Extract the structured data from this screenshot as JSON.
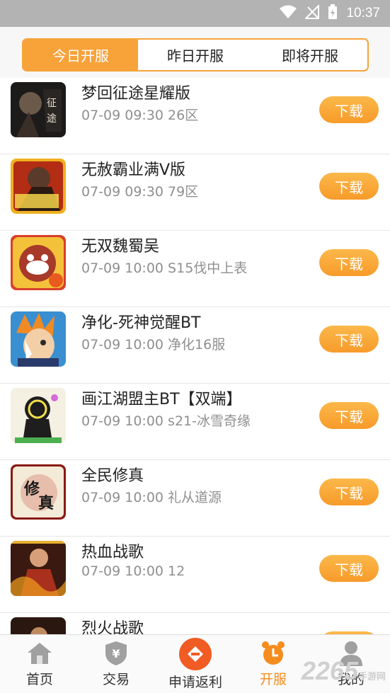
{
  "status": {
    "time": "10:37"
  },
  "tabs": [
    {
      "label": "今日开服"
    },
    {
      "label": "昨日开服"
    },
    {
      "label": "即将开服"
    }
  ],
  "games": [
    {
      "name": "梦回征途星耀版",
      "info": "07-09 09:30 26区",
      "button": "下载"
    },
    {
      "name": "无赦霸业满V版",
      "info": "07-09 09:30 79区",
      "button": "下载"
    },
    {
      "name": "无双魏蜀吴",
      "info": "07-09 10:00 S15伐中上表",
      "button": "下载"
    },
    {
      "name": "净化-死神觉醒BT",
      "info": "07-09 10:00 净化16服",
      "button": "下载"
    },
    {
      "name": "画江湖盟主BT【双端】",
      "info": "07-09 10:00 s21-冰雪奇缘",
      "button": "下载"
    },
    {
      "name": "全民修真",
      "info": "07-09 10:00 礼从道源",
      "button": "下载"
    },
    {
      "name": "热血战歌",
      "info": "07-09 10:00 12",
      "button": "下载"
    },
    {
      "name": "烈火战歌",
      "info": "",
      "button": "下载"
    }
  ],
  "nav": [
    {
      "label": "首页",
      "icon": "home-icon"
    },
    {
      "label": "交易",
      "icon": "shield-yen-icon"
    },
    {
      "label": "申请返利",
      "icon": "rebate-icon"
    },
    {
      "label": "开服",
      "icon": "alarm-clock-icon"
    },
    {
      "label": "我的",
      "icon": "user-icon"
    }
  ],
  "watermark": {
    "text": "2265",
    "sub": "手游网"
  },
  "colors": {
    "accent": "#f8a23a",
    "active_nav": "#f58d1e",
    "rebate": "#f15b24"
  }
}
